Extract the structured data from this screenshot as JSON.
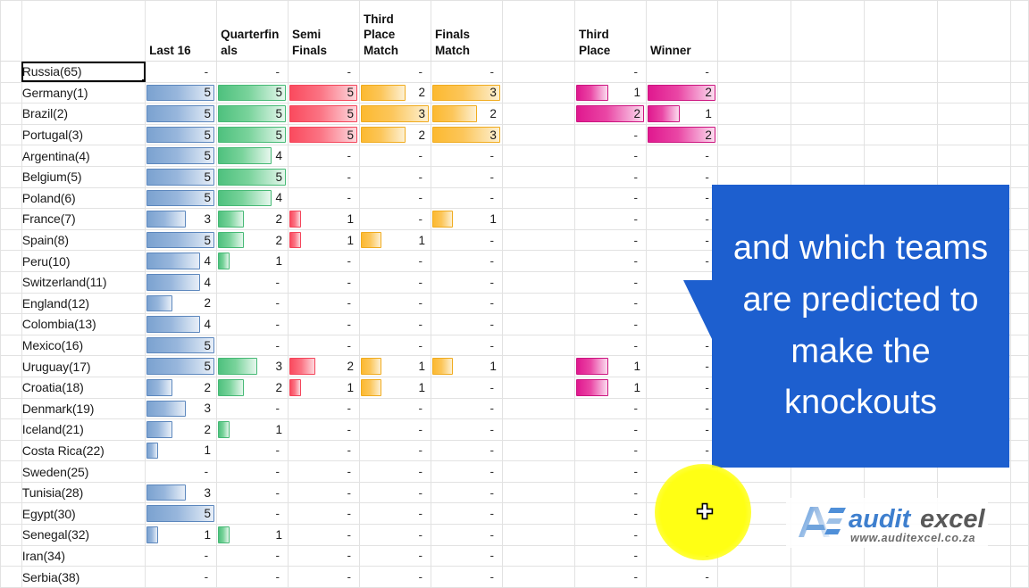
{
  "app": {
    "kind": "spreadsheet",
    "selected_cell_label": "Russia(65)"
  },
  "colors": {
    "callout_bg": "#1d5fcf",
    "callout_text": "#ffffff",
    "bar_last16": "#7ba2d0",
    "bar_quarterfinals": "#4fc17e",
    "bar_semifinals": "#fa4a5e",
    "bar_third_place_match": "#fcb930",
    "bar_finals_match": "#fcb930",
    "bar_third_place": "#e0188f",
    "bar_winner": "#e0188f",
    "cursor_highlight": "#ffff14",
    "grid_line": "#e2e2e2"
  },
  "table": {
    "headers": {
      "gutter": "",
      "team": "",
      "last16": "Last 16",
      "quarterfinals": "Quarterfinals",
      "semifinals": "Semi Finals",
      "third_place_match": "Third Place Match",
      "finals_match": "Finals Match",
      "spacer": "",
      "third_place": "Third Place",
      "winner": "Winner"
    },
    "dash": "-",
    "max_values": {
      "last16": 5,
      "quarterfinals": 5,
      "semifinals": 5,
      "third_place_match": 3,
      "finals_match": 3,
      "third_place": 2,
      "winner": 2
    },
    "rows": [
      {
        "team": "Russia(65)",
        "selected": true,
        "last16": null,
        "quarterfinals": null,
        "semifinals": null,
        "third_place_match": null,
        "finals_match": null,
        "third_place": null,
        "winner": null
      },
      {
        "team": "Germany(1)",
        "selected": false,
        "last16": 5,
        "quarterfinals": 5,
        "semifinals": 5,
        "third_place_match": 2,
        "finals_match": 3,
        "third_place": 1,
        "winner": 2
      },
      {
        "team": "Brazil(2)",
        "selected": false,
        "last16": 5,
        "quarterfinals": 5,
        "semifinals": 5,
        "third_place_match": 3,
        "finals_match": 2,
        "third_place": 2,
        "winner": 1
      },
      {
        "team": "Portugal(3)",
        "selected": false,
        "last16": 5,
        "quarterfinals": 5,
        "semifinals": 5,
        "third_place_match": 2,
        "finals_match": 3,
        "third_place": null,
        "winner": 2
      },
      {
        "team": "Argentina(4)",
        "selected": false,
        "last16": 5,
        "quarterfinals": 4,
        "semifinals": null,
        "third_place_match": null,
        "finals_match": null,
        "third_place": null,
        "winner": null
      },
      {
        "team": "Belgium(5)",
        "selected": false,
        "last16": 5,
        "quarterfinals": 5,
        "semifinals": null,
        "third_place_match": null,
        "finals_match": null,
        "third_place": null,
        "winner": null
      },
      {
        "team": "Poland(6)",
        "selected": false,
        "last16": 5,
        "quarterfinals": 4,
        "semifinals": null,
        "third_place_match": null,
        "finals_match": null,
        "third_place": null,
        "winner": null
      },
      {
        "team": "France(7)",
        "selected": false,
        "last16": 3,
        "quarterfinals": 2,
        "semifinals": 1,
        "third_place_match": null,
        "finals_match": 1,
        "third_place": null,
        "winner": null
      },
      {
        "team": "Spain(8)",
        "selected": false,
        "last16": 5,
        "quarterfinals": 2,
        "semifinals": 1,
        "third_place_match": 1,
        "finals_match": null,
        "third_place": null,
        "winner": null
      },
      {
        "team": "Peru(10)",
        "selected": false,
        "last16": 4,
        "quarterfinals": 1,
        "semifinals": null,
        "third_place_match": null,
        "finals_match": null,
        "third_place": null,
        "winner": null
      },
      {
        "team": "Switzerland(11)",
        "selected": false,
        "last16": 4,
        "quarterfinals": null,
        "semifinals": null,
        "third_place_match": null,
        "finals_match": null,
        "third_place": null,
        "winner": null
      },
      {
        "team": "England(12)",
        "selected": false,
        "last16": 2,
        "quarterfinals": null,
        "semifinals": null,
        "third_place_match": null,
        "finals_match": null,
        "third_place": null,
        "winner": null
      },
      {
        "team": "Colombia(13)",
        "selected": false,
        "last16": 4,
        "quarterfinals": null,
        "semifinals": null,
        "third_place_match": null,
        "finals_match": null,
        "third_place": null,
        "winner": null
      },
      {
        "team": "Mexico(16)",
        "selected": false,
        "last16": 5,
        "quarterfinals": null,
        "semifinals": null,
        "third_place_match": null,
        "finals_match": null,
        "third_place": null,
        "winner": null
      },
      {
        "team": "Uruguay(17)",
        "selected": false,
        "last16": 5,
        "quarterfinals": 3,
        "semifinals": 2,
        "third_place_match": 1,
        "finals_match": 1,
        "third_place": 1,
        "winner": null
      },
      {
        "team": "Croatia(18)",
        "selected": false,
        "last16": 2,
        "quarterfinals": 2,
        "semifinals": 1,
        "third_place_match": 1,
        "finals_match": null,
        "third_place": 1,
        "winner": null
      },
      {
        "team": "Denmark(19)",
        "selected": false,
        "last16": 3,
        "quarterfinals": null,
        "semifinals": null,
        "third_place_match": null,
        "finals_match": null,
        "third_place": null,
        "winner": null
      },
      {
        "team": "Iceland(21)",
        "selected": false,
        "last16": 2,
        "quarterfinals": 1,
        "semifinals": null,
        "third_place_match": null,
        "finals_match": null,
        "third_place": null,
        "winner": null
      },
      {
        "team": "Costa Rica(22)",
        "selected": false,
        "last16": 1,
        "quarterfinals": null,
        "semifinals": null,
        "third_place_match": null,
        "finals_match": null,
        "third_place": null,
        "winner": null
      },
      {
        "team": "Sweden(25)",
        "selected": false,
        "last16": null,
        "quarterfinals": null,
        "semifinals": null,
        "third_place_match": null,
        "finals_match": null,
        "third_place": null,
        "winner": null
      },
      {
        "team": "Tunisia(28)",
        "selected": false,
        "last16": 3,
        "quarterfinals": null,
        "semifinals": null,
        "third_place_match": null,
        "finals_match": null,
        "third_place": null,
        "winner": null
      },
      {
        "team": "Egypt(30)",
        "selected": false,
        "last16": 5,
        "quarterfinals": null,
        "semifinals": null,
        "third_place_match": null,
        "finals_match": null,
        "third_place": null,
        "winner": null
      },
      {
        "team": "Senegal(32)",
        "selected": false,
        "last16": 1,
        "quarterfinals": 1,
        "semifinals": null,
        "third_place_match": null,
        "finals_match": null,
        "third_place": null,
        "winner": null
      },
      {
        "team": "Iran(34)",
        "selected": false,
        "last16": null,
        "quarterfinals": null,
        "semifinals": null,
        "third_place_match": null,
        "finals_match": null,
        "third_place": null,
        "winner": null
      },
      {
        "team": "Serbia(38)",
        "selected": false,
        "last16": null,
        "quarterfinals": null,
        "semifinals": null,
        "third_place_match": null,
        "finals_match": null,
        "third_place": null,
        "winner": null
      }
    ]
  },
  "callout": {
    "text": "and which teams are predicted to make the knockouts"
  },
  "cursor": {
    "icon": "crosshair-cursor-icon"
  },
  "logo": {
    "word_one": "audit",
    "word_two": "excel",
    "url": "www.auditexcel.co.za",
    "mark": "ae-logo-mark-icon"
  }
}
